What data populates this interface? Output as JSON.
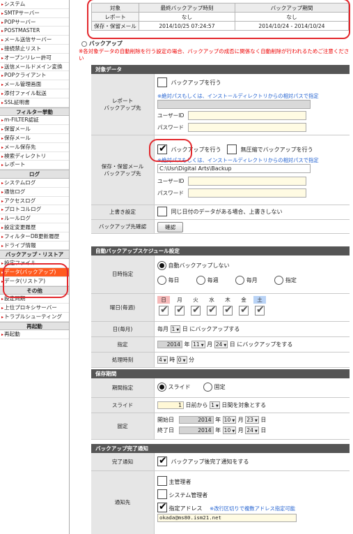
{
  "sidebar": {
    "groups": [
      {
        "heading": "",
        "items": [
          "システム",
          "SMTPサーバー",
          "POPサーバー",
          "POSTMASTER",
          "メール送信サーバー",
          "接続禁止リスト",
          "オープンリレー許可",
          "送信メールドメイン変換",
          "POPクライアント",
          "メール管理画面",
          "添付ファイル転送",
          "SSL証明書"
        ]
      },
      {
        "heading": "フィルター挙動",
        "items": [
          "m-FILTER認証",
          "保留メール",
          "保存メール",
          "メール保存先",
          "検索ディレクトリ",
          "レポート"
        ]
      },
      {
        "heading": "ログ",
        "items": [
          "システムログ",
          "通信ログ",
          "アクセスログ",
          "プロトコルログ",
          "ルールログ",
          "設定変更履歴",
          "フィルターDB更新履歴",
          "ドライブ情報"
        ]
      },
      {
        "heading": "バックアップ・リストア",
        "items": [
          "設定ファイル",
          "データ(バックアップ)",
          "データ(リストア)"
        ]
      },
      {
        "heading": "その他",
        "items": [
          "設定同期",
          "上位プロキシサーバー",
          "トラブルシューティング"
        ]
      },
      {
        "heading": "再起動",
        "items": [
          "再起動"
        ]
      }
    ],
    "active_item": "データ(バックアップ)"
  },
  "status_table": {
    "headers": [
      "対象",
      "最終バックアップ時刻",
      "バックアップ期間"
    ],
    "rows": [
      [
        "レポート",
        "なし",
        "なし"
      ],
      [
        "保存・保留メール",
        "2014/10/25 07:24:57",
        "2014/10/24 - 2014/10/24"
      ]
    ]
  },
  "backup_title": "バックアップ",
  "warning": "※各対象データの自動削除を行う設定の場合、バックアップの成否に関係なく自動削除が行われるためご注意ください",
  "target_section": {
    "heading": "対象データ",
    "report": {
      "label": "レポート\nバックアップ先",
      "enable_label": "バックアップを行う",
      "enabled": false,
      "path_note": "※絶対パスもしくは、インストールディレクトリからの相対パスで指定",
      "path_value": "",
      "user_label": "ユーザーID",
      "pass_label": "パスワード"
    },
    "mail": {
      "label": "保存・保留メール\nバックアップ先",
      "enable_label": "バックアップを行う",
      "enabled": true,
      "nocompress_label": "無圧縮でバックアップを行う",
      "nocompress": false,
      "path_note": "※絶対パスもしくは、インストールディレクトリからの相対パスで指定",
      "path_value": "C:\\Usr\\Digital Arts\\Backup",
      "user_label": "ユーザーID",
      "pass_label": "パスワード"
    },
    "overwrite": {
      "label": "上書き設定",
      "option": "同じ日付のデータがある場合、上書きしない",
      "checked": false
    },
    "confirm": {
      "label": "バックアップ先確認",
      "button": "確認"
    }
  },
  "schedule_section": {
    "heading": "自動バックアップスケジュール設定",
    "timing": {
      "label": "日時指定",
      "options": [
        "自動バックアップしない",
        "毎日",
        "毎週",
        "毎月",
        "指定"
      ],
      "selected": 0
    },
    "weekday": {
      "label": "曜日(毎週)",
      "days": [
        "日",
        "月",
        "火",
        "水",
        "木",
        "金",
        "土"
      ],
      "checked": [
        true,
        true,
        true,
        true,
        true,
        true,
        true
      ]
    },
    "day_monthly": {
      "label": "日(毎月)",
      "prefix": "毎月",
      "value": "1",
      "suffix": "日 にバックアップする"
    },
    "specified": {
      "label": "指定",
      "year": "2014",
      "year_unit": "年",
      "month": "11",
      "month_unit": "月",
      "day": "24",
      "suffix": "日 にバックアップをする"
    },
    "time": {
      "label": "処理時刻",
      "hour": "4",
      "hour_unit": "時",
      "minute": "0",
      "minute_unit": "分"
    }
  },
  "retention_section": {
    "heading": "保存期間",
    "mode": {
      "label": "期間指定",
      "options": [
        "スライド",
        "固定"
      ],
      "selected": 0
    },
    "slide": {
      "label": "スライド",
      "days_ago": "1",
      "days_ago_unit": "日前から",
      "count": "1",
      "suffix": "日間を対象とする"
    },
    "fixed": {
      "label": "固定",
      "start_label": "開始日",
      "start_year": "2014",
      "start_month": "10",
      "start_day": "23",
      "end_label": "終了日",
      "end_year": "2014",
      "end_month": "10",
      "end_day": "24",
      "year_unit": "年",
      "month_unit": "月",
      "day_unit": "日"
    }
  },
  "notify_section": {
    "heading": "バックアップ完了通知",
    "done": {
      "label": "完了通知",
      "option": "バックアップ後完了通知をする",
      "checked": true
    },
    "dest": {
      "label": "通知先",
      "admin": "主管理者",
      "admin_checked": false,
      "sysadmin": "システム管理者",
      "sysadmin_checked": false,
      "address": "指定アドレス",
      "address_checked": true,
      "address_note": "※改行区切りで複数アドレス指定可能",
      "address_value": "okada@ms80.ism21.net"
    }
  }
}
